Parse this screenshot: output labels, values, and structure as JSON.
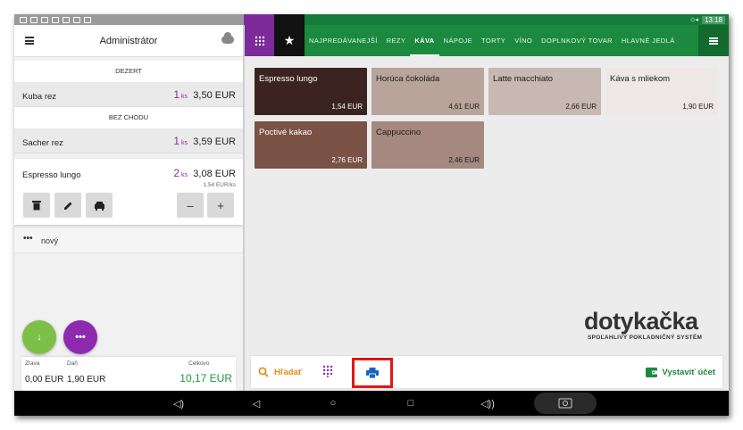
{
  "header": {
    "title": "Administrátor"
  },
  "order": {
    "sections": [
      {
        "label": "DEZERT",
        "items": [
          {
            "name": "Kuba rez",
            "qty": "1",
            "unit": "ks",
            "price": "3,50 EUR"
          }
        ]
      },
      {
        "label": "BEZ CHODU",
        "items": [
          {
            "name": "Sacher rez",
            "qty": "1",
            "unit": "ks",
            "price": "3,59 EUR"
          }
        ]
      }
    ],
    "selected": {
      "name": "Espresso lungo",
      "qty": "2",
      "unit": "ks",
      "price": "3,08 EUR",
      "unit_price": "1,54 EUR/ks"
    },
    "new_label": "nový",
    "new_dots": "•••"
  },
  "actions": {
    "minus": "–",
    "plus": "+"
  },
  "fab": {
    "more": "•••",
    "download": "↓"
  },
  "totals": {
    "discount_label": "Zľava",
    "discount_value": "0,00 EUR",
    "tax_label": "Daň",
    "tax_value": "1,90 EUR",
    "total_label": "Celkovo",
    "total_value": "10,17 EUR"
  },
  "nav": {
    "categories": [
      {
        "label": "NAJPREDÁVANEJŠÍ"
      },
      {
        "label": "REZY"
      },
      {
        "label": "KÁVA"
      },
      {
        "label": "NÁPOJE"
      },
      {
        "label": "TORTY"
      },
      {
        "label": "VÍNO"
      },
      {
        "label": "DOPLNKOVÝ TOVAR"
      },
      {
        "label": "HLAVNÉ JEDLÁ"
      }
    ],
    "active_index": 2,
    "star": "★"
  },
  "products": [
    {
      "name": "Espresso lungo",
      "price": "1,54 EUR",
      "color": "#3b2420",
      "text": "#ffffff"
    },
    {
      "name": "Horúca čokoláda",
      "price": "4,61 EUR",
      "color": "#b8a49a",
      "text": "#1c1c1c"
    },
    {
      "name": "Latte macchiato",
      "price": "2,66 EUR",
      "color": "#c7b8b1",
      "text": "#1c1c1c"
    },
    {
      "name": "Káva s mliekom",
      "price": "1,90 EUR",
      "color": "#ede8e6",
      "text": "#1c1c1c"
    },
    {
      "name": "Poctivé kakao",
      "price": "2,76 EUR",
      "color": "#7b5246",
      "text": "#ffffff"
    },
    {
      "name": "Cappuccino",
      "price": "2,46 EUR",
      "color": "#a58980",
      "text": "#1c1c1c"
    }
  ],
  "logo": {
    "word": "dotykačka",
    "tagline": "SPOĽAHLIVÝ POKLADNIČNÝ SYSTÉM"
  },
  "actionbar": {
    "search_label": "Hľadať",
    "bill_label": "Vystaviť účet"
  },
  "statusbar": {
    "time": "13:18"
  },
  "colors": {
    "accent_green": "#1b8a3e",
    "accent_purple": "#8a2aa8",
    "search_orange": "#e48a13",
    "highlight_red": "#e01818"
  }
}
